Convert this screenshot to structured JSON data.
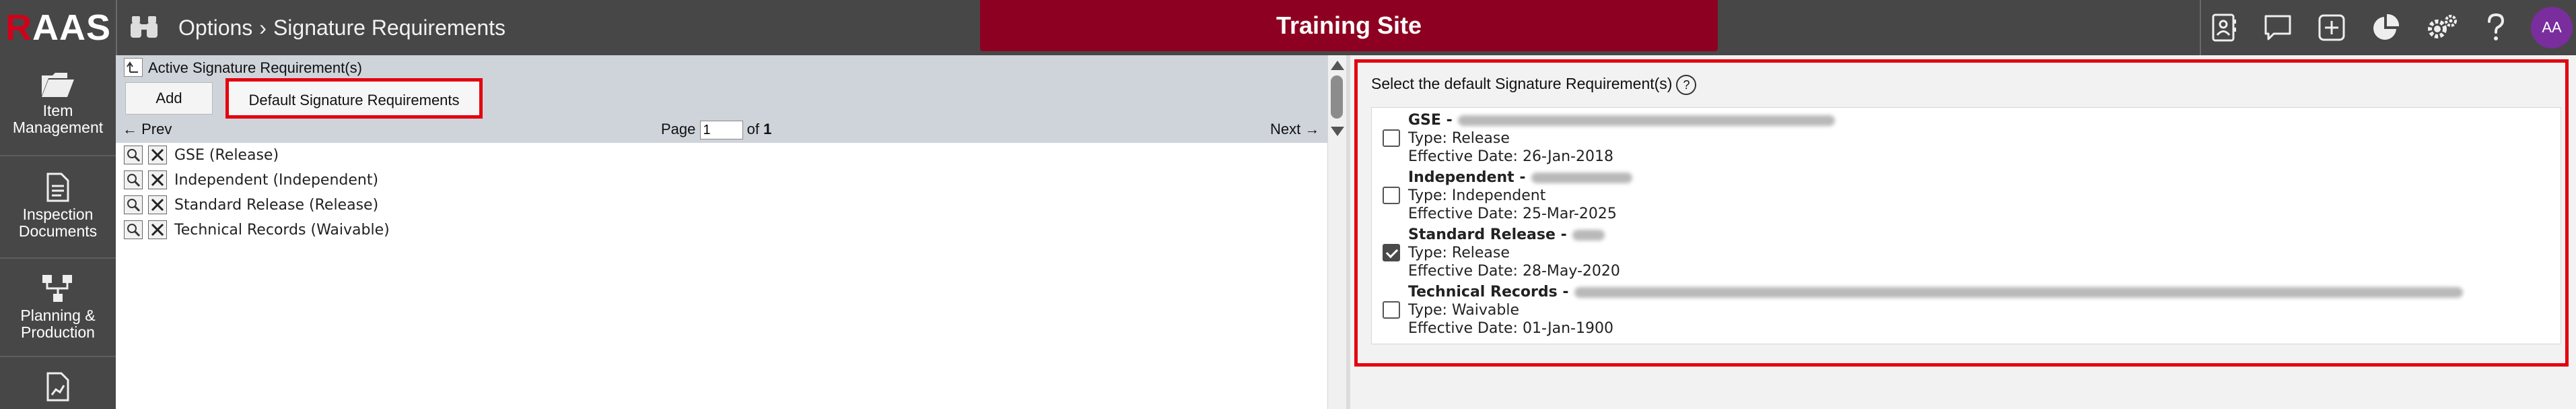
{
  "app": {
    "logo_first": "R",
    "logo_rest": "AAS",
    "breadcrumb_root": "Options",
    "breadcrumb_sep": "›",
    "breadcrumb_page": "Signature Requirements",
    "site_banner": "Training Site",
    "avatar_initials": "AA"
  },
  "nav": {
    "items": [
      {
        "label_line1": "Item",
        "label_line2": "Management"
      },
      {
        "label_line1": "Inspection",
        "label_line2": "Documents"
      },
      {
        "label_line1": "Planning &",
        "label_line2": "Production"
      }
    ]
  },
  "toolbar": {
    "title": "Active Signature Requirement(s)",
    "add_label": "Add",
    "default_label": "Default Signature Requirements"
  },
  "pager": {
    "prev": "← Prev",
    "page_label": "Page",
    "page_value": "1",
    "of_label": "of",
    "total_pages": "1",
    "next": "Next →"
  },
  "list": {
    "rows": [
      {
        "text": "GSE (Release)"
      },
      {
        "text": "Independent (Independent)"
      },
      {
        "text": "Standard Release (Release)"
      },
      {
        "text": "Technical Records (Waivable)"
      }
    ]
  },
  "defaults": {
    "title": "Select the default Signature Requirement(s)",
    "help": "?",
    "items": [
      {
        "name": "GSE -",
        "type": "Type: Release",
        "effective": "Effective Date: 26-Jan-2018",
        "checked": false
      },
      {
        "name": "Independent -",
        "type": "Type: Independent",
        "effective": "Effective Date: 25-Mar-2025",
        "checked": false
      },
      {
        "name": "Standard Release -",
        "type": "Type: Release",
        "effective": "Effective Date: 28-May-2020",
        "checked": true
      },
      {
        "name": "Technical Records -",
        "type": "Type: Waivable",
        "effective": "Effective Date: 01-Jan-1900",
        "checked": false
      }
    ]
  },
  "colors": {
    "topbar": "#474747",
    "banner": "#8e0021",
    "highlight": "#e3000f",
    "avatar": "#7a2d9c"
  }
}
